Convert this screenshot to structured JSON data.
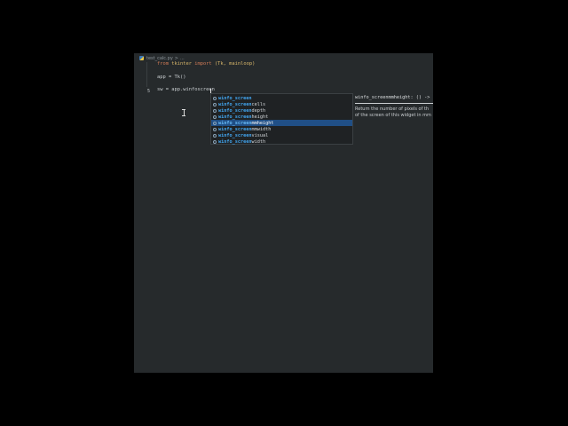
{
  "breadcrumb": {
    "file": "test_calc.py",
    "sep": ">",
    "rest": "..."
  },
  "editor": {
    "active_line_number": "5",
    "lines": {
      "l1": {
        "kw_from": "from",
        "module": "tkinter",
        "kw_import": "import",
        "names": "(Tk, mainloop)"
      },
      "l3": {
        "text": "app = Tk()"
      },
      "l5": {
        "text": "sw = app.winfoscreen"
      }
    }
  },
  "completion": {
    "items": [
      {
        "match": "winfo_screen",
        "rest": ""
      },
      {
        "match": "winfo_screen",
        "rest": "cells"
      },
      {
        "match": "winfo_screen",
        "rest": "depth"
      },
      {
        "match": "winfo_screen",
        "rest": "height"
      },
      {
        "match": "winfo_screen",
        "rest": "mmheight"
      },
      {
        "match": "winfo_screen",
        "rest": "mmwidth"
      },
      {
        "match": "winfo_screen",
        "rest": "visual"
      },
      {
        "match": "winfo_screen",
        "rest": "width"
      }
    ],
    "selected_index": 4
  },
  "doc": {
    "signature": "winfo_screenmmheight: () ->",
    "text_line1": "Return the number of pixels of th",
    "text_line2": "of the screen of this widget in mm"
  },
  "colors": {
    "background": "#262a2c",
    "selection": "#204f86",
    "match": "#42a5ef",
    "keyword": "#d07a56"
  }
}
